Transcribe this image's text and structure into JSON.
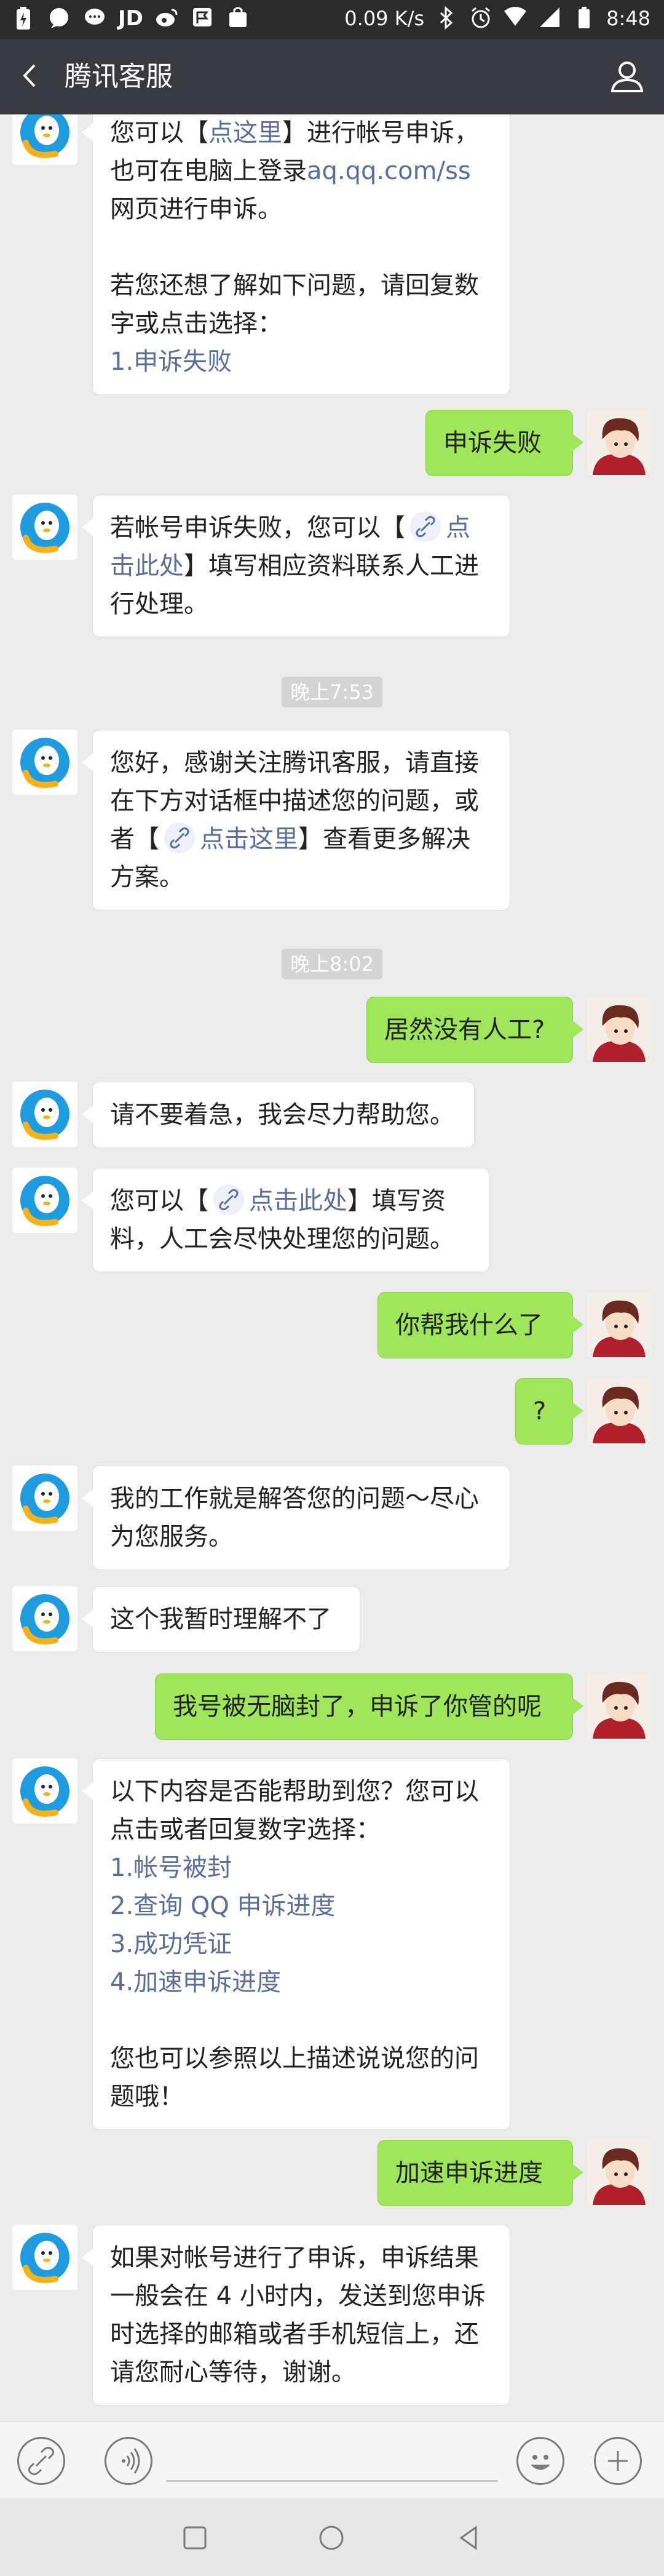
{
  "status_bar": {
    "left_icons": [
      "battery-charging-icon",
      "chat-icon",
      "message-icon",
      "jd-icon",
      "weibo-icon",
      "flag-icon",
      "bag-icon"
    ],
    "jd_label": "JD",
    "net_speed": "0.09 K/s",
    "time": "8:48"
  },
  "header": {
    "title": "腾讯客服"
  },
  "messages": [
    {
      "side": "left",
      "text_before": "您可以【",
      "link": "点这里",
      "text_after": "】进行帐号申诉，\n也可在电脑上登录",
      "link2": "aq.qq.com/ss",
      "text_end": "\n网页进行申诉。\n\n若您还想了解如下问题，请回复数\n字或点击选择：",
      "option": "1.申诉失败"
    },
    {
      "side": "right",
      "text": "申诉失败"
    },
    {
      "side": "left",
      "text_before": "若帐号申诉失败，您可以【",
      "link": "点\n击此处",
      "text_after": "】填写相应资料联系人工进\n行处理。"
    },
    {
      "type": "time",
      "text": "晚上7:53"
    },
    {
      "side": "left",
      "text_before": "您好，感谢关注腾讯客服，请直接\n在下方对话框中描述您的问题，或\n者【",
      "link": "点击这里",
      "text_after": "】查看更多解决\n方案。"
    },
    {
      "type": "time",
      "text": "晚上8:02"
    },
    {
      "side": "right",
      "text": "居然没有人工?"
    },
    {
      "side": "left",
      "text": "请不要着急，我会尽力帮助您。"
    },
    {
      "side": "left",
      "text_before": "您可以【",
      "link": "点击此处",
      "text_after": "】填写资\n料，人工会尽快处理您的问题。"
    },
    {
      "side": "right",
      "text": "你帮我什么了"
    },
    {
      "side": "right",
      "text": "?"
    },
    {
      "side": "left",
      "text": "我的工作就是解答您的问题～尽心\n为您服务。"
    },
    {
      "side": "left",
      "text": "这个我暂时理解不了"
    },
    {
      "side": "right",
      "text": "我号被无脑封了，申诉了你管的呢"
    },
    {
      "side": "left",
      "text_intro": "以下内容是否能帮助到您？您可以\n点击或者回复数字选择：",
      "options": [
        "1.帐号被封",
        "2.查询 QQ 申诉进度",
        "3.成功凭证",
        "4.加速申诉进度"
      ],
      "text_outro": "您也可以参照以上描述说说您的问\n题哦！"
    },
    {
      "side": "right",
      "text": "加速申诉进度"
    },
    {
      "side": "left",
      "text": "如果对帐号进行了申诉，申诉结果\n一般会在 4 小时内，发送到您申诉\n时选择的邮箱或者手机短信上，还\n请您耐心等待，谢谢。"
    }
  ],
  "input_bar": {
    "left_icons": [
      "link-icon",
      "voice-icon"
    ],
    "right_icons": [
      "emoji-icon",
      "plus-icon"
    ]
  },
  "nav_bar": {
    "icons": [
      "recents-icon",
      "home-icon",
      "back-triangle-icon"
    ]
  }
}
